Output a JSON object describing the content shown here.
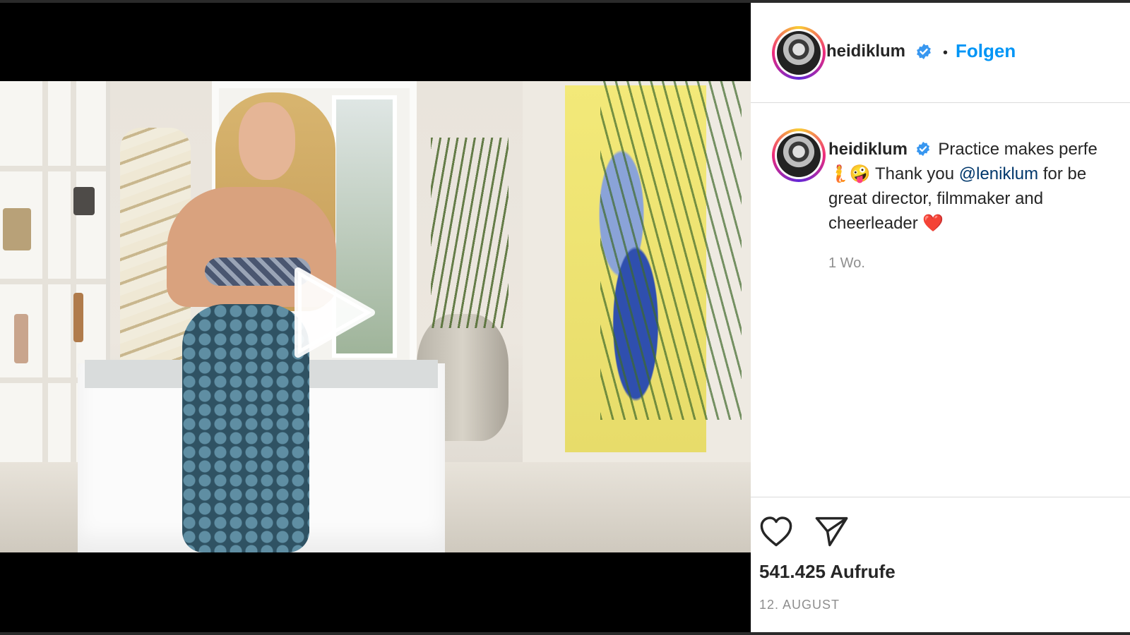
{
  "post": {
    "username": "heidiklum",
    "separator": "•",
    "follow_label": "Folgen",
    "caption_line1": "Practice makes perfe",
    "caption_line2_emoji1": "🧜",
    "caption_line2_emoji2": "🤪",
    "caption_line2_prefix": "Thank you ",
    "caption_mention": "@leniklum",
    "caption_line2_suffix": " for be",
    "caption_line3": "great director, filmmaker and",
    "caption_line4": "cheerleader",
    "caption_heart": "❤️",
    "time_ago": "1 Wo.",
    "views": "541.425 Aufrufe",
    "date": "12. AUGUST"
  },
  "icons": {
    "verified": "verified-badge-icon",
    "play": "play-icon",
    "like": "heart-outline-icon",
    "share": "paper-plane-icon"
  },
  "colors": {
    "link_blue": "#0095f6",
    "verified_blue": "#3897f0",
    "mention": "#00376b",
    "muted": "#8e8e8e",
    "text": "#262626"
  }
}
